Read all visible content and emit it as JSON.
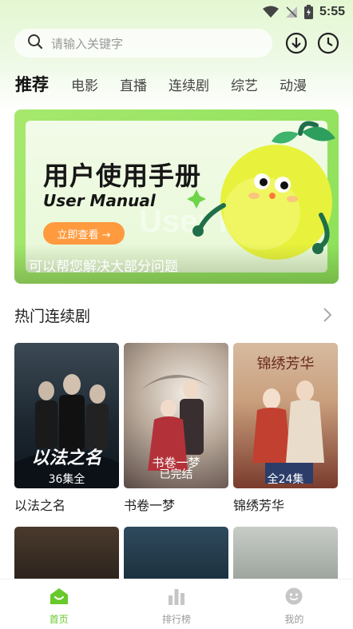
{
  "status_bar": {
    "time": "5:55",
    "icons": [
      "wifi-icon",
      "signal-off-icon",
      "battery-icon"
    ]
  },
  "search": {
    "placeholder": "请输入关键字",
    "icons": [
      "search-icon",
      "download-icon",
      "history-icon"
    ]
  },
  "tabs": [
    {
      "label": "推荐",
      "active": true
    },
    {
      "label": "电影"
    },
    {
      "label": "直播"
    },
    {
      "label": "连续剧"
    },
    {
      "label": "综艺"
    },
    {
      "label": "动漫"
    }
  ],
  "banner": {
    "title": "用户使用手册",
    "subtitle": "User Manual",
    "button": "立即查看 →",
    "ghost": "User Manual",
    "caption": "可以帮您解决大部分问题"
  },
  "section": {
    "title": "热门连续剧",
    "more_icon": "chevron-right-icon"
  },
  "dramas": [
    {
      "title": "以法之名",
      "badge": "36集全",
      "poster_text": "以法之名"
    },
    {
      "title": "书卷一梦",
      "badge": "已完结",
      "poster_text": "书卷一梦"
    },
    {
      "title": "锦绣芳华",
      "badge": "全24集",
      "poster_text": "锦绣芳华"
    }
  ],
  "bottom_nav": [
    {
      "label": "首页",
      "icon": "home-icon",
      "active": true
    },
    {
      "label": "排行榜",
      "icon": "ranking-icon"
    },
    {
      "label": "我的",
      "icon": "profile-icon"
    }
  ],
  "colors": {
    "accent": "#67c92a",
    "banner_button": "#ff9a3e",
    "banner_green": "#8ee15b"
  }
}
